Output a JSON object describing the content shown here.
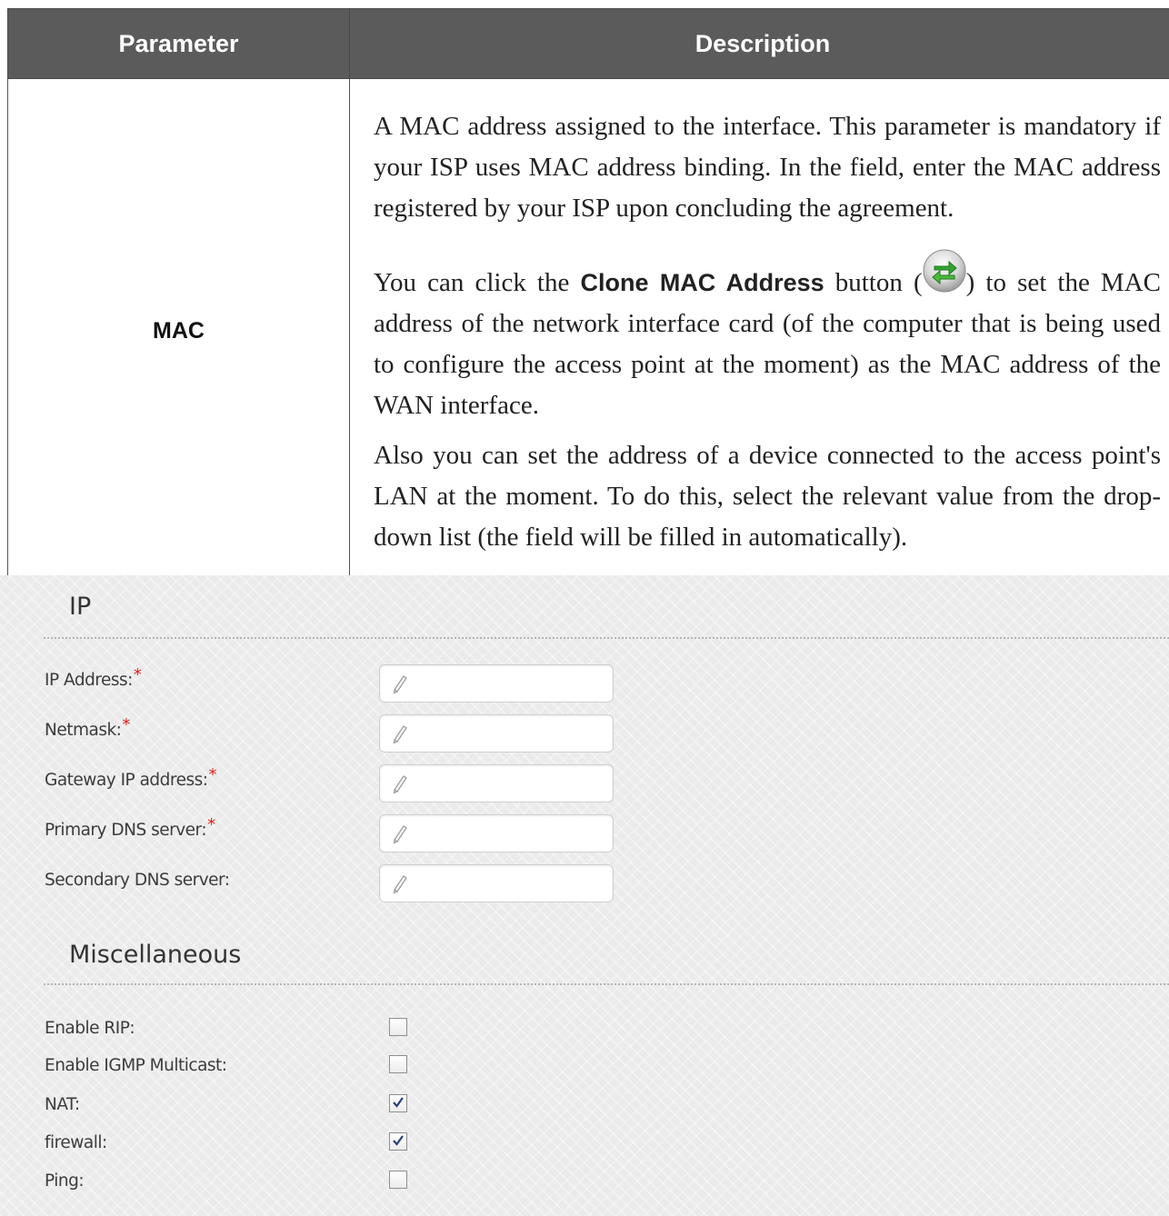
{
  "table": {
    "headers": {
      "parameter": "Parameter",
      "description": "Description"
    },
    "row": {
      "parameter": "MAC",
      "desc_p1": "A MAC address assigned to the interface. This parameter is mandatory if your ISP uses MAC address binding. In the field, enter the MAC address registered by your ISP upon concluding the agreement.",
      "desc_p2_pre": "You can click the ",
      "desc_p2_button": "Clone MAC Address",
      "desc_p2_mid": " button (",
      "desc_p2_post": ") to set the MAC address of the network interface card (of the computer that is being used to configure the access point at the moment) as the MAC address of the WAN interface.",
      "desc_p3": "Also you can set the address of a device connected to the access point's LAN at the moment. To do this, select the relevant value from the drop-down list (the field will be filled in automatically).",
      "icon": "clone-mac-arrows-icon"
    }
  },
  "ip_section": {
    "title": "IP",
    "required_mark": "*",
    "fields": [
      {
        "label": "IP Address:",
        "required": true,
        "value": "",
        "icon": "pencil-icon"
      },
      {
        "label": "Netmask:",
        "required": true,
        "value": "",
        "icon": "pencil-icon"
      },
      {
        "label": "Gateway IP address:",
        "required": true,
        "value": "",
        "icon": "pencil-icon"
      },
      {
        "label": "Primary DNS server:",
        "required": true,
        "value": "",
        "icon": "pencil-icon"
      },
      {
        "label": "Secondary DNS server:",
        "required": false,
        "value": "",
        "icon": "pencil-icon"
      }
    ]
  },
  "misc_section": {
    "title": "Miscellaneous",
    "options": [
      {
        "label": "Enable RIP:",
        "checked": false
      },
      {
        "label": "Enable IGMP Multicast:",
        "checked": false
      },
      {
        "label": "NAT:",
        "checked": true
      },
      {
        "label": "firewall:",
        "checked": true
      },
      {
        "label": "Ping:",
        "checked": false
      }
    ]
  },
  "colors": {
    "header_bg": "#5b5b5b",
    "required": "#e0201b",
    "icon_green": "#3aa63a",
    "panel_bg": "#ebebeb"
  }
}
